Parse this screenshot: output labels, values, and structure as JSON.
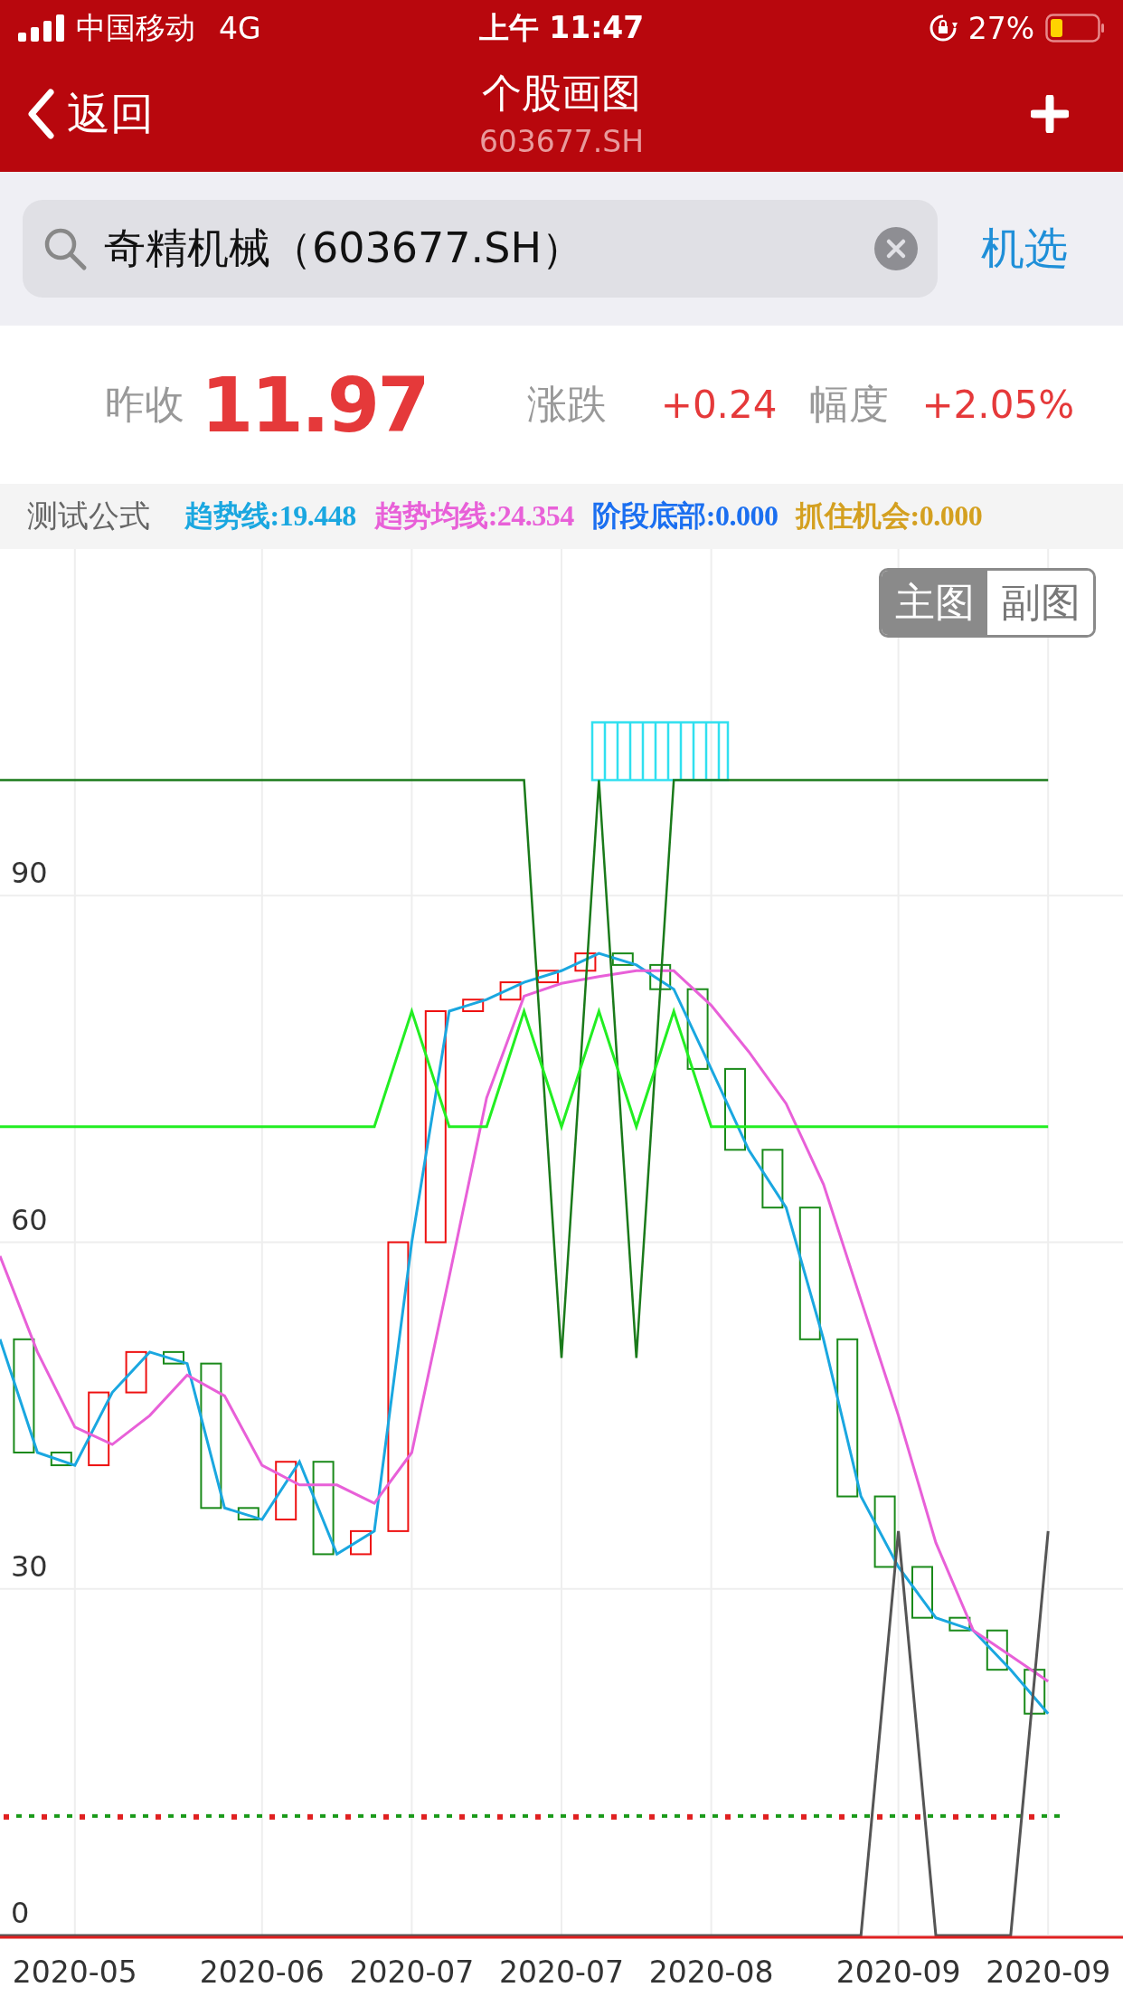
{
  "status_bar": {
    "carrier": "中国移动",
    "network": "4G",
    "time": "上午 11:47",
    "battery": "27%"
  },
  "nav": {
    "back": "返回",
    "title": "个股画图",
    "subtitle": "603677.SH"
  },
  "search": {
    "value": "奇精机械（603677.SH）",
    "action": "机选"
  },
  "quote": {
    "prev_close_label": "昨收",
    "prev_close": "11.97",
    "change_label": "涨跌",
    "change": "+0.24",
    "range_label": "幅度",
    "range": "+2.05%"
  },
  "formula": {
    "name": "测试公式",
    "indicators": [
      {
        "label": "趋势线:19.448",
        "color": "#1aa7e0"
      },
      {
        "label": "趋势均线:24.354",
        "color": "#e860d8"
      },
      {
        "label": "阶段底部:0.000",
        "color": "#1b6ff0"
      },
      {
        "label": "抓住机会:0.000",
        "color": "#d4a020"
      }
    ]
  },
  "chart": {
    "tabs": [
      {
        "label": "主图",
        "selected": true
      },
      {
        "label": "副图",
        "selected": false
      }
    ],
    "chart_data": {
      "type": "line",
      "grid": true,
      "ylim": [
        0,
        120
      ],
      "yticks": [
        0,
        30,
        60,
        90
      ],
      "categories": [
        null,
        null,
        "2020-05",
        null,
        null,
        null,
        null,
        "2020-06",
        null,
        null,
        null,
        "2020-07",
        null,
        null,
        null,
        "2020-07",
        null,
        null,
        null,
        "2020-08",
        null,
        null,
        null,
        null,
        "2020-09",
        null,
        null,
        null,
        "2020-09",
        null
      ],
      "series": [
        {
          "color": "#1aa7e0",
          "values": [
            51.6,
            41.8,
            40.7,
            47,
            50.5,
            49.5,
            37,
            36,
            41,
            33,
            35,
            60,
            80,
            81,
            82.5,
            83.5,
            85,
            84,
            81.9,
            75,
            68,
            63,
            51.6,
            38,
            31.9,
            27.5,
            26.4,
            23,
            19.2,
            null
          ]
        },
        {
          "color": "#e860d8",
          "values": [
            58.8,
            50.5,
            44,
            42.5,
            45,
            48.5,
            46.7,
            40.7,
            39,
            39,
            37.4,
            41.8,
            57,
            72.5,
            81.3,
            82.4,
            83,
            83.5,
            83.5,
            80.5,
            76.5,
            72,
            65,
            55,
            45,
            34,
            26.4,
            24.2,
            22,
            null
          ]
        },
        {
          "color": "#1a7a1a",
          "values": [
            100,
            100,
            100,
            100,
            100,
            100,
            100,
            100,
            100,
            100,
            100,
            100,
            100,
            100,
            100,
            50,
            100,
            50,
            100,
            100,
            100,
            100,
            100,
            100,
            100,
            100,
            100,
            100,
            100,
            null
          ]
        },
        {
          "color": "#22ee22",
          "values": [
            70,
            70,
            70,
            70,
            70,
            70,
            70,
            70,
            70,
            70,
            70,
            80,
            70,
            70,
            80,
            70,
            80,
            70,
            80,
            70,
            70,
            70,
            70,
            70,
            70,
            70,
            70,
            70,
            70,
            null
          ]
        },
        {
          "color": "#555555",
          "values": [
            0,
            0,
            0,
            0,
            0,
            0,
            0,
            0,
            0,
            0,
            0,
            0,
            0,
            0,
            0,
            0,
            0,
            0,
            0,
            0,
            0,
            0,
            0,
            0,
            35,
            0,
            0,
            0,
            35,
            null
          ]
        }
      ]
    }
  }
}
